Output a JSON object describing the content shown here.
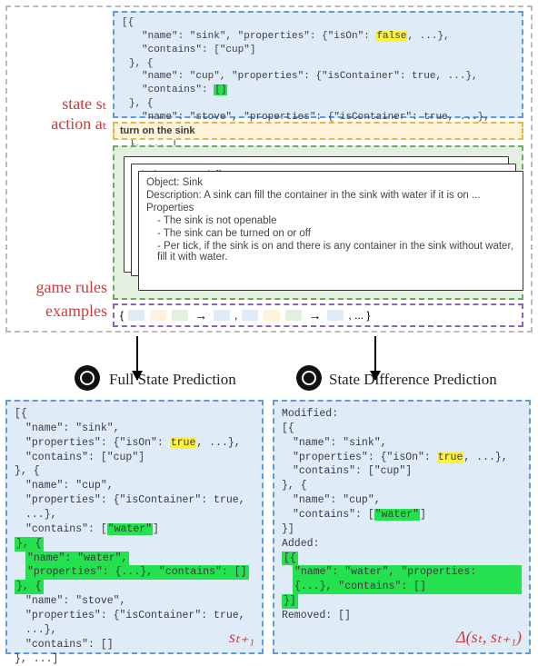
{
  "labels": {
    "state": "state sₜ",
    "action": "action aₜ",
    "rules": "game rules",
    "examples": "examples"
  },
  "state_block": {
    "l1": "[{",
    "l2": "\"name\": \"sink\", \"properties\": {\"isOn\":",
    "l2hl": "false",
    "l2b": ", ...}, \"contains\": [\"cup\"]",
    "l3": "}, {",
    "l4": "\"name\": \"cup\", \"properties\": {\"isContainer\": true, ...}, \"contains\":",
    "l4hl": "[]",
    "l5": "}, {",
    "l6": "\"name\": \"stove\", \"properties\": {\"isContainer\": true, ...}, \"contains\": []",
    "l7": "}, ... ]"
  },
  "action_text": "turn on the sink",
  "card": {
    "back_action": "Action: turn on/off",
    "object": "Object: Sink",
    "desc": "Description: A sink can fill the container in the sink with water if it is on ...",
    "props": "Properties",
    "p1": "- The sink is not openable",
    "p2": "- The sink can be turned on or off",
    "p3": "- Per tick, if the sink is on and there is any container in the sink without water, fill it with water."
  },
  "examples": "{               →        ,               →      , ... }",
  "pred_titles": {
    "full": "Full State Prediction",
    "diff": "State Difference Prediction"
  },
  "full": {
    "l1": "[{",
    "l2a": "\"name\": \"sink\",",
    "l3a": "\"properties\": {\"isOn\":",
    "l3hl": "true",
    "l3b": ", ...},",
    "l4": "\"contains\": [\"cup\"]",
    "l5": "}, {",
    "l6": "\"name\": \"cup\",",
    "l7": "\"properties\": {\"isContainer\": true, ...},",
    "l8a": "\"contains\": [",
    "l8hl": "\"water\"",
    "l8b": "]",
    "l9": "}, {",
    "l10": "\"name\": \"water\",",
    "l11": "\"properties\": {...}, \"contains\": []",
    "l12": "}, {",
    "l13": "\"name\": \"stove\",",
    "l14": "\"properties\": {\"isContainer\": true, ...},",
    "l15": "\"contains\": []",
    "l16": "}, ...]",
    "tag": "sₜ₊₁"
  },
  "diff": {
    "l1": "Modified:",
    "l2": "[{",
    "l3": "\"name\": \"sink\",",
    "l4a": "\"properties\": {\"isOn\":",
    "l4hl": "true",
    "l4b": ", ...},",
    "l5": "\"contains\": [\"cup\"]",
    "l6": "}, {",
    "l7": "\"name\": \"cup\",",
    "l8a": "\"contains\": [",
    "l8hl": "\"water\"",
    "l8b": "]",
    "l9": "}]",
    "l10": "Added:",
    "l11": "[{",
    "l12": "\"name\": \"water\", \"properties: {...}, \"contains\": []",
    "l13": "}]",
    "l14": "Removed: []",
    "tag": "Δ(sₜ, sₜ₊₁)"
  }
}
